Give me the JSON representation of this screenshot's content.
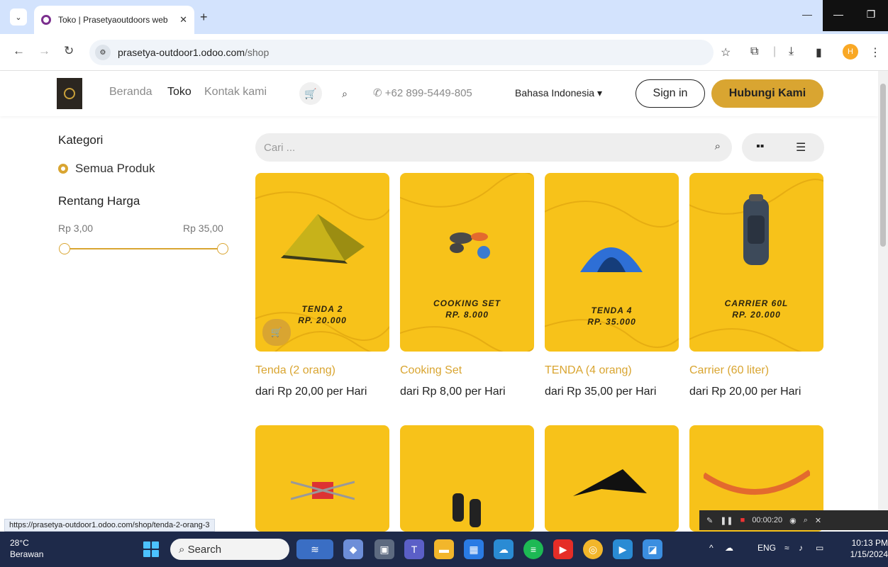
{
  "browser": {
    "tab_title": "Toko | Prasetyaoutdoors web",
    "url_host": "prasetya-outdoor1.odoo.com",
    "url_path": "/shop",
    "profile_initial": "H"
  },
  "header": {
    "nav": [
      "Beranda",
      "Toko",
      "Kontak kami"
    ],
    "phone": "+62 899-5449-805",
    "language": "Bahasa Indonesia",
    "sign_in": "Sign in",
    "contact": "Hubungi Kami"
  },
  "sidebar": {
    "category_title": "Kategori",
    "category_all": "Semua Produk",
    "price_title": "Rentang Harga",
    "price_min": "Rp 3,00",
    "price_max": "Rp 35,00"
  },
  "search": {
    "placeholder": "Cari ..."
  },
  "products": [
    {
      "caption1": "TENDA 2",
      "caption2": "RP. 20.000",
      "name": "Tenda (2 orang)",
      "price": "dari Rp 20,00 per Hari"
    },
    {
      "caption1": "COOKING SET",
      "caption2": "RP. 8.000",
      "name": "Cooking Set",
      "price": "dari Rp 8,00 per Hari"
    },
    {
      "caption1": "TENDA 4",
      "caption2": "RP. 35.000",
      "name": "TENDA (4 orang)",
      "price": "dari Rp 35,00 per Hari"
    },
    {
      "caption1": "CARRIER 60L",
      "caption2": "RP. 20.000",
      "name": "Carrier (60 liter)",
      "price": "dari Rp 20,00 per Hari"
    }
  ],
  "status_url": "https://prasetya-outdoor1.odoo.com/shop/tenda-2-orang-3",
  "recorder_time": "00:00:20",
  "taskbar": {
    "temperature": "28°C",
    "weather": "Berawan",
    "search": "Search",
    "lang": "ENG",
    "time": "10:13 PM",
    "date": "1/15/2024"
  }
}
